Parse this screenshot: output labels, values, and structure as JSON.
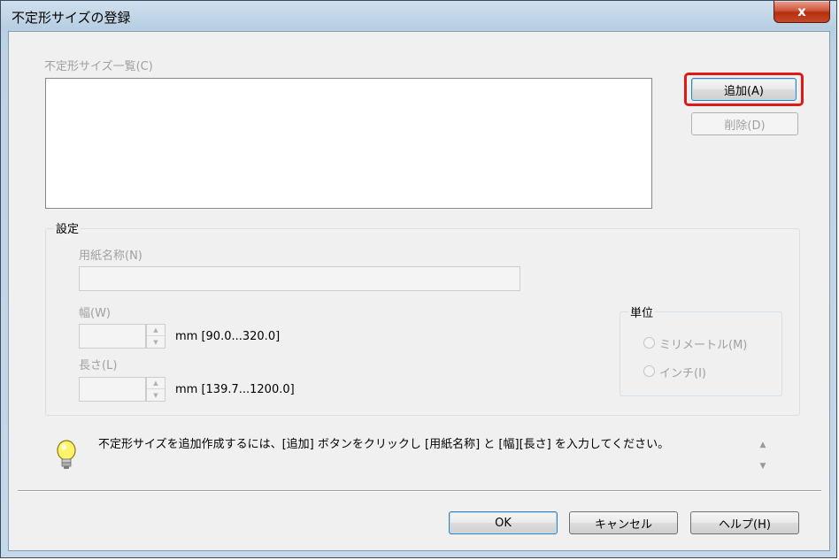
{
  "window": {
    "title": "不定形サイズの登録",
    "close_label": "x"
  },
  "list": {
    "label": "不定形サイズ一覧(C)",
    "items": []
  },
  "buttons": {
    "add": "追加(A)",
    "delete": "削除(D)",
    "ok": "OK",
    "cancel": "キャンセル",
    "help": "ヘルプ(H)"
  },
  "settings": {
    "group_title": "設定",
    "paper_name_label": "用紙名称(N)",
    "paper_name_value": "",
    "width_label": "幅(W)",
    "width_value": "",
    "width_range": "mm [90.0...320.0]",
    "length_label": "長さ(L)",
    "length_value": "",
    "length_range": "mm [139.7...1200.0]"
  },
  "unit": {
    "group_title": "単位",
    "options": [
      {
        "label": "ミリメートル(M)",
        "selected": false
      },
      {
        "label": "インチ(I)",
        "selected": false
      }
    ]
  },
  "hint": {
    "icon": "lightbulb-icon",
    "text": "不定形サイズを追加作成するには、[追加] ボタンをクリックし [用紙名称] と [幅][長さ] を入力してください。"
  },
  "colors": {
    "highlight_border": "#e01818",
    "dialog_background": "#f0f0f0",
    "close_button": "#c7482a"
  }
}
